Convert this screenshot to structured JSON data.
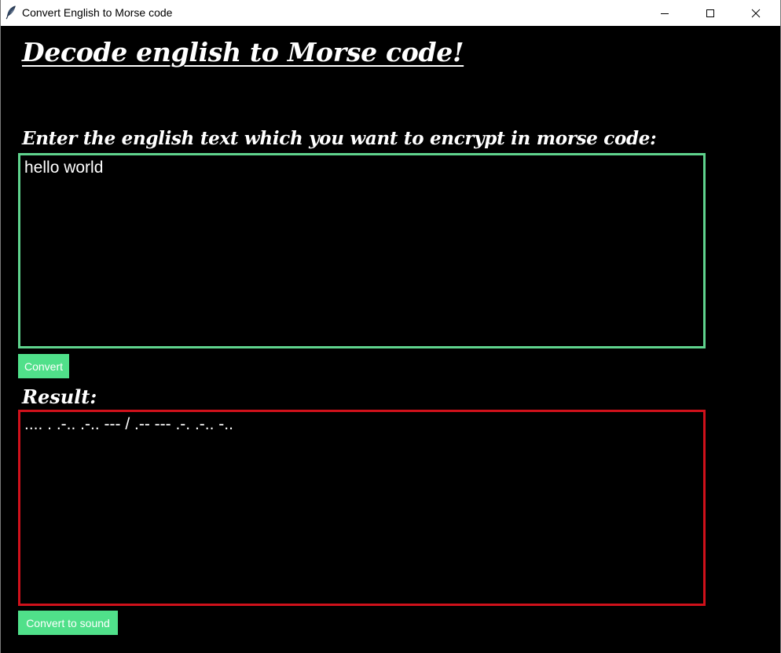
{
  "window": {
    "title": "Convert English to Morse code",
    "icon": "feather-icon",
    "controls": [
      "minimize-icon",
      "maximize-icon",
      "close-icon"
    ]
  },
  "main": {
    "heading": "Decode english to Morse code!",
    "input_label": "Enter the english text which you want to encrypt in morse code:",
    "input_value": "hello world",
    "convert_label": "Convert",
    "result_label": "Result:",
    "result_value": ".... . .-.. .-.. --- / .-- --- .-. .-.. -..",
    "sound_label": "Convert to sound"
  },
  "colors": {
    "background": "#000000",
    "input_border": "#5fd38d",
    "result_border": "#d0111b",
    "button_bg": "#50e08a",
    "text": "#ffffff"
  }
}
